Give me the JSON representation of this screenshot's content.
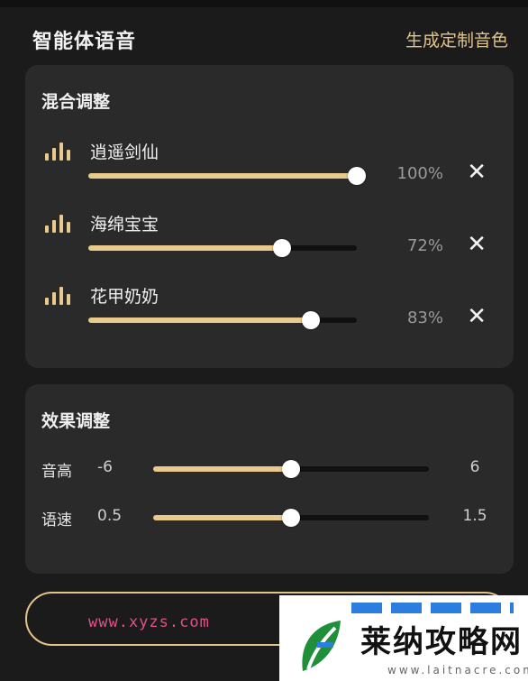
{
  "header": {
    "title": "智能体语音",
    "custom_voice_link": "生成定制音色"
  },
  "mix": {
    "title": "混合调整",
    "voices": [
      {
        "name": "逍遥剑仙",
        "value": 1.0,
        "percent_label": "100%",
        "remove_label": "✕"
      },
      {
        "name": "海绵宝宝",
        "value": 0.72,
        "percent_label": "72%",
        "remove_label": "✕"
      },
      {
        "name": "花甲奶奶",
        "value": 0.83,
        "percent_label": "83%",
        "remove_label": "✕"
      }
    ]
  },
  "effects": {
    "title": "效果调整",
    "rows": [
      {
        "label": "音高",
        "min_label": "-6",
        "max_label": "6",
        "value": 0.5
      },
      {
        "label": "语速",
        "min_label": "0.5",
        "max_label": "1.5",
        "value": 0.5
      }
    ]
  },
  "watermark": {
    "url_text": "www.xyzs.com",
    "logo_name": "莱纳攻略网",
    "logo_url": "www.laitnacre.com"
  },
  "colors": {
    "accent": "#e9c98c",
    "background": "#1b1b1b",
    "card": "#2a2a2a"
  },
  "icons": {
    "voice": "waveform-icon",
    "remove": "close-icon"
  }
}
